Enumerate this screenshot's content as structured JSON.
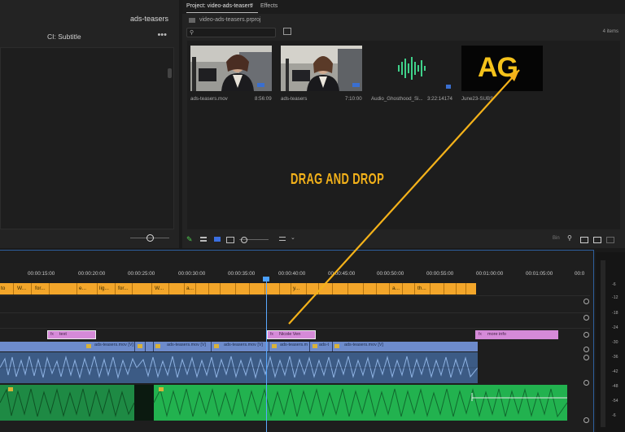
{
  "left_panel": {
    "title": "ads-teasers",
    "subtitle": "CI: Subtitle",
    "menu": "•••"
  },
  "project": {
    "tab_project": "Project: video-ads-teasers",
    "tab_menu": "≡",
    "tab_effects": "Effects",
    "path": "video-ads-teasers.prproj",
    "search_placeholder": "",
    "item_count": "4 items",
    "items": [
      {
        "name": "ads-teasers.mov",
        "duration": "8:56:09"
      },
      {
        "name": "ads-teasers",
        "duration": "7:10:00"
      },
      {
        "name": "Audio_Ghosthood_Si...",
        "duration": "3:22:14174"
      },
      {
        "name": "June23-SUBS",
        "duration": ""
      }
    ],
    "thumb_logo_text": "AG"
  },
  "annotation": {
    "drag_drop": "DRAG AND DROP",
    "arrow_color": "#f4b21a"
  },
  "timeline": {
    "timecodes": [
      "00:00:15:00",
      "00:00:20:00",
      "00:00:25:00",
      "00:00:30:00",
      "00:00:35:00",
      "00:00:40:00",
      "00:00:45:00",
      "00:00:50:00",
      "00:00:55:00",
      "00:01:00:00",
      "00:01:05:00",
      "00:0"
    ],
    "captions": [
      "to",
      "W...",
      "for...",
      "e...",
      "lig...",
      "for...",
      "W...",
      "a...",
      "y...",
      "a...",
      "th..."
    ],
    "graphics": [
      {
        "label": "text"
      },
      {
        "label": "Nicole Ven"
      },
      {
        "label": "more info"
      }
    ],
    "video_clips": [
      "ads-teasers.mov [V]",
      "ads-teasers.mov [V]",
      "ads-teasers.mov [V]",
      "ads-teasers.m",
      "ads-t",
      "ads-teasers.mov [V]"
    ],
    "fx_label": "fx",
    "db_scale": [
      "-6",
      "-12",
      "-18",
      "-24",
      "-30",
      "-36",
      "-42",
      "-48",
      "-54",
      "-6"
    ]
  }
}
